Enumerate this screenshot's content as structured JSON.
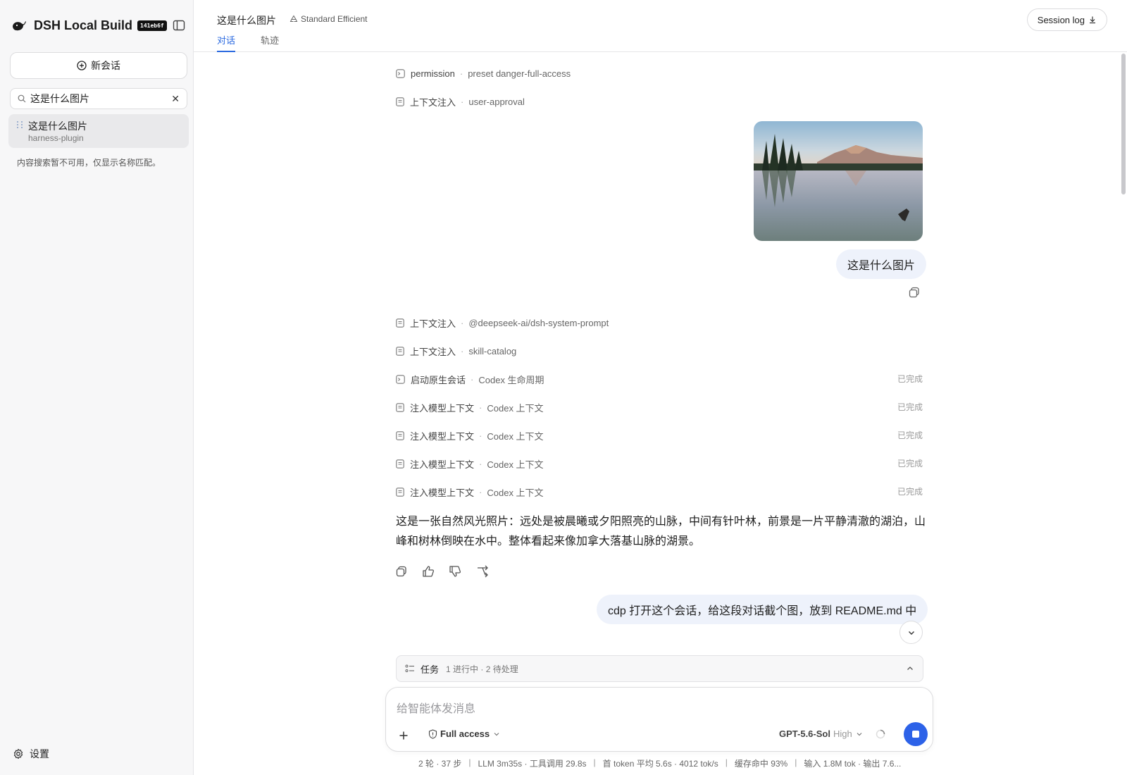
{
  "sidebar": {
    "app_title": "DSH Local Build",
    "build_hash": "141eb6f",
    "new_chat_label": "新会话",
    "search_value": "这是什么图片",
    "conversations": [
      {
        "title": "这是什么图片",
        "subtitle": "harness-plugin"
      }
    ],
    "search_note": "内容搜索暂不可用，仅显示名称匹配。",
    "settings_label": "设置"
  },
  "header": {
    "title": "这是什么图片",
    "mode": "Standard Efficient",
    "tabs": [
      {
        "label": "对话",
        "active": true
      },
      {
        "label": "轨迹",
        "active": false
      }
    ],
    "session_log_label": "Session log"
  },
  "steps_top": [
    {
      "icon": "terminal-icon",
      "key": "permission",
      "value": "preset danger-full-access"
    },
    {
      "icon": "document-icon",
      "key": "上下文注入",
      "value": "user-approval"
    }
  ],
  "user_message_1": "这是什么图片",
  "steps_mid": [
    {
      "icon": "document-icon",
      "key": "上下文注入",
      "value": "@deepseek-ai/dsh-system-prompt",
      "status": ""
    },
    {
      "icon": "document-icon",
      "key": "上下文注入",
      "value": "skill-catalog",
      "status": ""
    },
    {
      "icon": "terminal-icon",
      "key": "启动原生会话",
      "value": "Codex 生命周期",
      "status": "已完成"
    },
    {
      "icon": "document-icon",
      "key": "注入模型上下文",
      "value": "Codex 上下文",
      "status": "已完成"
    },
    {
      "icon": "document-icon",
      "key": "注入模型上下文",
      "value": "Codex 上下文",
      "status": "已完成"
    },
    {
      "icon": "document-icon",
      "key": "注入模型上下文",
      "value": "Codex 上下文",
      "status": "已完成"
    },
    {
      "icon": "document-icon",
      "key": "注入模型上下文",
      "value": "Codex 上下文",
      "status": "已完成"
    }
  ],
  "assistant_answer": "这是一张自然风光照片：远处是被晨曦或夕阳照亮的山脉，中间有针叶林，前景是一片平静清澈的湖泊，山峰和树林倒映在水中。整体看起来像加拿大落基山脉的湖景。",
  "user_message_2": "cdp 打开这个会话，给这段对话截个图，放到 README.md 中",
  "tasks": {
    "label": "任务",
    "info": "1 进行中 · 2 待处理"
  },
  "composer": {
    "placeholder": "给智能体发消息",
    "access_label": "Full access",
    "model": "GPT-5.6-Sol",
    "effort": "High"
  },
  "stats": [
    "2 轮 · 37 步",
    "LLM 3m35s · 工具调用 29.8s",
    "首 token 平均 5.6s · 4012 tok/s",
    "缓存命中 93%",
    "输入 1.8M tok · 输出 7.6..."
  ],
  "colors": {
    "accent": "#2b6ae0",
    "bubble": "#eef2fb",
    "sidebar_bg": "#f7f7f8"
  }
}
